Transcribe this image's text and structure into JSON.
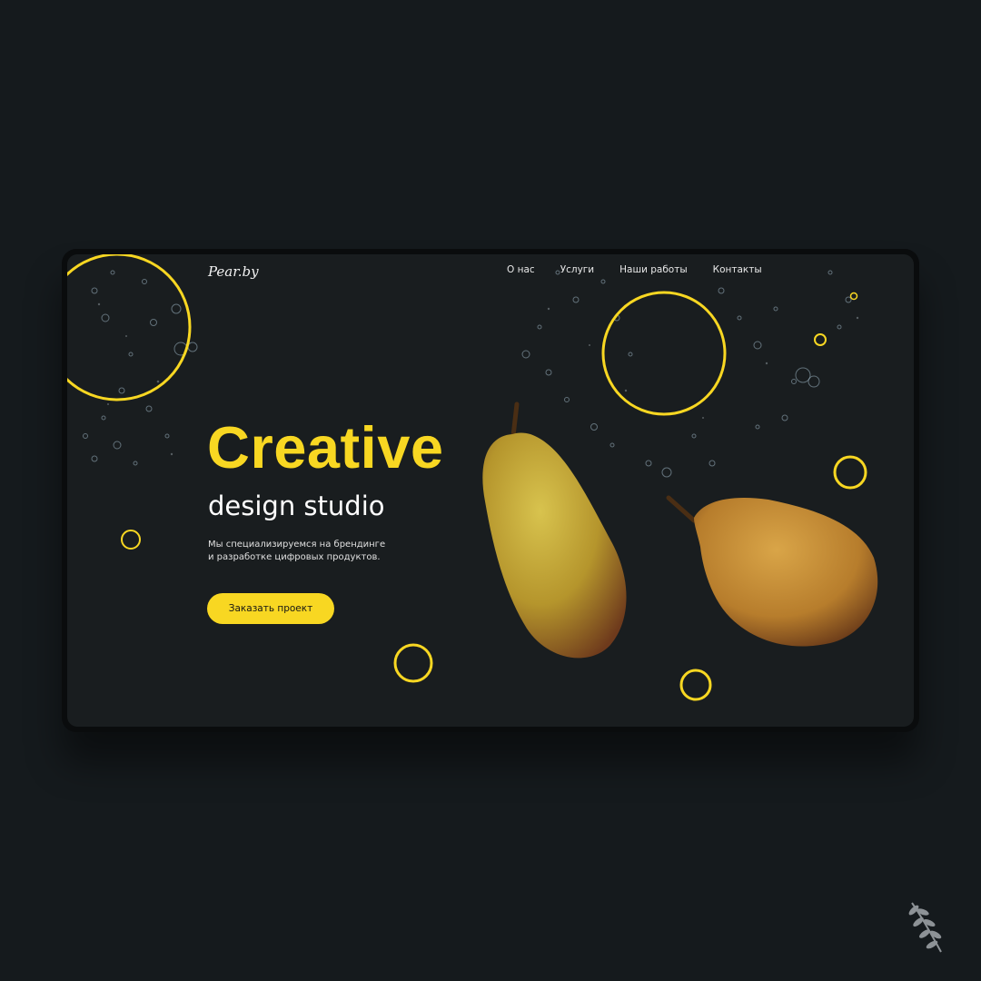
{
  "logo": "Pear.by",
  "nav": [
    "О нас",
    "Услуги",
    "Наши работы",
    "Контакты"
  ],
  "hero": {
    "title": "Creative",
    "subtitle": "design studio",
    "description": [
      "Мы специализируемся на брендинге",
      "и разработке цифровых продуктов."
    ],
    "cta": "Заказать проект"
  },
  "colors": {
    "accent": "#f8d722",
    "background": "#191d1f",
    "page": "#151a1d"
  },
  "icons": {
    "watermark": "laurel-branch-icon"
  }
}
